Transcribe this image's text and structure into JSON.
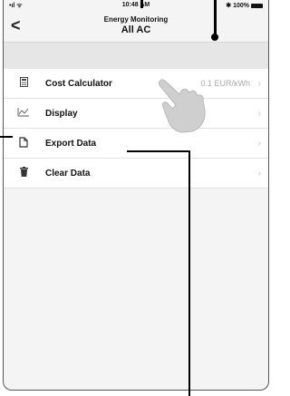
{
  "status": {
    "signal": "•ıl ᯤ",
    "time": "10:48 AM",
    "battery": "✱ 100%"
  },
  "nav": {
    "back": "<",
    "subtitle": "Energy Monitoring",
    "title": "All AC"
  },
  "menu": [
    {
      "icon": "calculator-icon",
      "label": "Cost Calculator",
      "value": "0.1 EUR/kWh"
    },
    {
      "icon": "chart-icon",
      "label": "Display"
    },
    {
      "icon": "export-icon",
      "label": "Export Data"
    },
    {
      "icon": "trash-icon",
      "label": "Clear Data"
    }
  ]
}
